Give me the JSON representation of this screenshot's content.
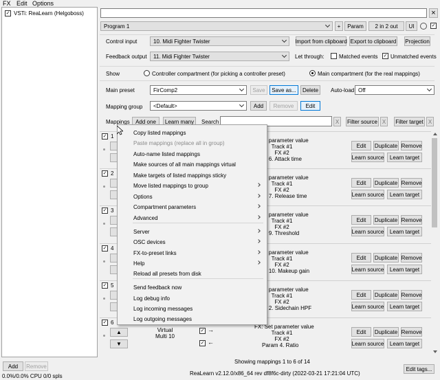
{
  "menubar": [
    "FX",
    "Edit",
    "Options"
  ],
  "fx_chain": {
    "item_label": "VSTi: ReaLearn (Helgoboss)",
    "add_label": "Add",
    "remove_label": "Remove",
    "status": "0.0%/0.0% CPU 0/0 spls"
  },
  "header": {
    "close_glyph": "×",
    "program": "Program 1",
    "plus": "+",
    "param": "Param",
    "io": "2 in 2 out",
    "ui": "UI"
  },
  "control_input": {
    "label": "Control input",
    "value": "10. Midi Fighter Twister"
  },
  "feedback_output": {
    "label": "Feedback output",
    "value": "11. Midi Fighter Twister"
  },
  "io_buttons": {
    "import": "Import from clipboard",
    "export": "Export to clipboard",
    "projection": "Projection",
    "let_through": "Let through:",
    "matched": "Matched events",
    "unmatched": "Unmatched events"
  },
  "show": {
    "label": "Show",
    "controller": "Controller compartment (for picking a controller preset)",
    "main": "Main compartment (for the real mappings)"
  },
  "preset": {
    "label": "Main preset",
    "value": "FirComp2",
    "save": "Save",
    "save_as": "Save as...",
    "delete": "Delete",
    "auto_load": "Auto-load",
    "auto_value": "Off"
  },
  "group": {
    "label": "Mapping group",
    "value": "<Default>",
    "add": "Add",
    "remove": "Remove",
    "edit": "Edit"
  },
  "mappings_bar": {
    "label": "Mappings",
    "add_one": "Add one",
    "learn_many": "Learn many",
    "search": "Search",
    "x": "X",
    "filter_source": "Filter source",
    "filter_target": "Filter target"
  },
  "rows": [
    {
      "num": "1",
      "t1": "et parameter value",
      "t2": "Track #1",
      "t3": "FX #2",
      "t4": "m 6. Attack time"
    },
    {
      "num": "2",
      "t1": "et parameter value",
      "t2": "Track #1",
      "t3": "FX #2",
      "t4": "m 7. Release time"
    },
    {
      "num": "3",
      "t1": "et parameter value",
      "t2": "Track #1",
      "t3": "FX #2",
      "t4": "m 9. Threshold"
    },
    {
      "num": "4",
      "t1": "et parameter value",
      "t2": "Track #1",
      "t3": "FX #2",
      "t4": "m 10. Makeup gain"
    },
    {
      "num": "5",
      "t1": "et parameter value",
      "t2": "Track #1",
      "t3": "FX #2",
      "t4": "m 2. Sidechain HPF"
    },
    {
      "num": "6",
      "t1": "FX: Set parameter value",
      "t2": "Track #1",
      "t3": "FX #2",
      "t4": "Param 4. Ratio",
      "src1": "Virtual",
      "src2": "Multi 10"
    }
  ],
  "row_buttons": {
    "edit": "Edit",
    "duplicate": "Duplicate",
    "remove": "Remove",
    "learn_source": "Learn source",
    "learn_target": "Learn target"
  },
  "context_menu": {
    "items": [
      {
        "label": "Copy listed mappings"
      },
      {
        "label": "Paste mappings (replace all in group)",
        "disabled": true
      },
      {
        "label": "Auto-name listed mappings"
      },
      {
        "label": "Make sources of all main mappings virtual"
      },
      {
        "label": "Make targets of listed mappings sticky"
      },
      {
        "label": "Move listed mappings to group",
        "submenu": true
      },
      {
        "label": "Options",
        "submenu": true
      },
      {
        "label": "Compartment parameters",
        "submenu": true
      },
      {
        "label": "Advanced",
        "submenu": true
      },
      {
        "label": "Server",
        "submenu": true
      },
      {
        "label": "OSC devices",
        "submenu": true
      },
      {
        "label": "FX-to-preset links",
        "submenu": true
      },
      {
        "label": "Help",
        "submenu": true
      },
      {
        "label": "Reload all presets from disk"
      },
      {
        "label": "Send feedback now"
      },
      {
        "label": "Log debug info"
      },
      {
        "label": "Log incoming messages"
      },
      {
        "label": "Log outgoing messages"
      }
    ]
  },
  "footer": {
    "showing": "Showing mappings 1 to 6 of 14",
    "version": "ReaLearn v2.12.0/x86_64 rev df8f6c-dirty (2022-03-21 17:21:04 UTC)",
    "edit_tags": "Edit tags..."
  }
}
